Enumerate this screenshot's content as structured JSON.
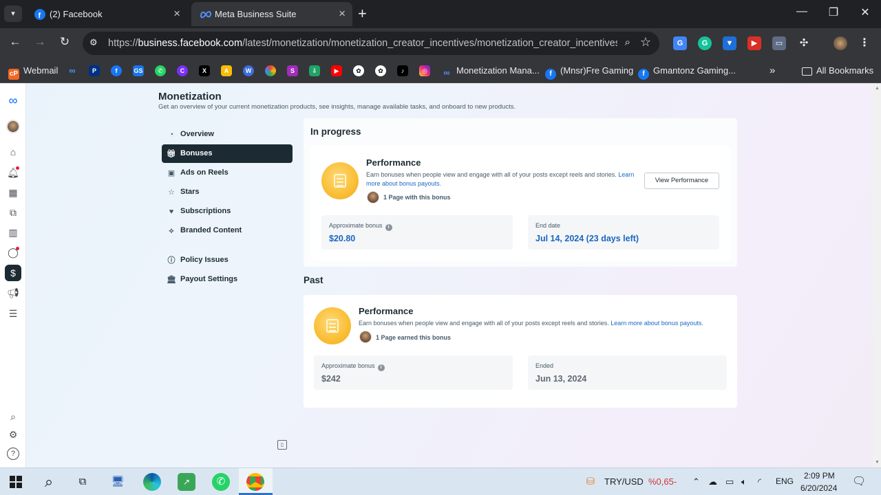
{
  "browser": {
    "tabs": [
      {
        "title": "(2) Facebook",
        "active": false
      },
      {
        "title": "Meta Business Suite",
        "active": true
      }
    ],
    "url_prefix": "https://",
    "url_host": "business.facebook.com",
    "url_path": "/latest/monetization/monetization_creator_incentives/monetization_creator_incentives...",
    "bookmarks": [
      {
        "label": "Webmail"
      },
      {
        "label": "Monetization Mana..."
      },
      {
        "label": "(Mnsr)Fre Gaming"
      },
      {
        "label": "Gmantonz Gaming..."
      },
      {
        "label": "All Bookmarks"
      }
    ]
  },
  "page": {
    "title": "Monetization",
    "subtitle": "Get an overview of your current monetization products, see insights, manage available tasks, and onboard to new products.",
    "nav": [
      {
        "label": "Overview",
        "icon": "overview-icon",
        "active": false
      },
      {
        "label": "Bonuses",
        "icon": "gift-icon",
        "active": true
      },
      {
        "label": "Ads on Reels",
        "icon": "reels-icon",
        "active": false
      },
      {
        "label": "Stars",
        "icon": "stars-icon",
        "active": false
      },
      {
        "label": "Subscriptions",
        "icon": "subscriptions-icon",
        "active": false
      },
      {
        "label": "Branded Content",
        "icon": "handshake-icon",
        "active": false
      },
      {
        "label": "Policy Issues",
        "icon": "alert-icon",
        "active": false
      },
      {
        "label": "Payout Settings",
        "icon": "bank-icon",
        "active": false
      }
    ],
    "in_progress": {
      "heading": "In progress",
      "card": {
        "title": "Performance",
        "desc": "Earn bonuses when people view and engage with all of your posts except reels and stories.",
        "link": "Learn more about bonus payouts.",
        "pages": "1 Page with this bonus",
        "button": "View Performance",
        "stat1_label": "Approximate bonus",
        "stat1_value": "$20.80",
        "stat2_label": "End date",
        "stat2_value": "Jul 14, 2024 (23 days left)"
      }
    },
    "past": {
      "heading": "Past",
      "card": {
        "title": "Performance",
        "desc": "Earn bonuses when people view and engage with all of your posts except reels and stories.",
        "link": "Learn more about bonus payouts.",
        "pages": "1 Page earned this bonus",
        "stat1_label": "Approximate bonus",
        "stat1_value": "$242",
        "stat2_label": "Ended",
        "stat2_value": "Jun 13, 2024"
      }
    }
  },
  "taskbar": {
    "ticker": "TRY/USD",
    "ticker_change": "%0,65-",
    "lang": "ENG",
    "time": "2:09 PM",
    "date": "6/20/2024"
  },
  "colors": {
    "accent_blue": "#1a66c2",
    "dark_nav": "#1c2b33",
    "coin": "#f9be35"
  }
}
